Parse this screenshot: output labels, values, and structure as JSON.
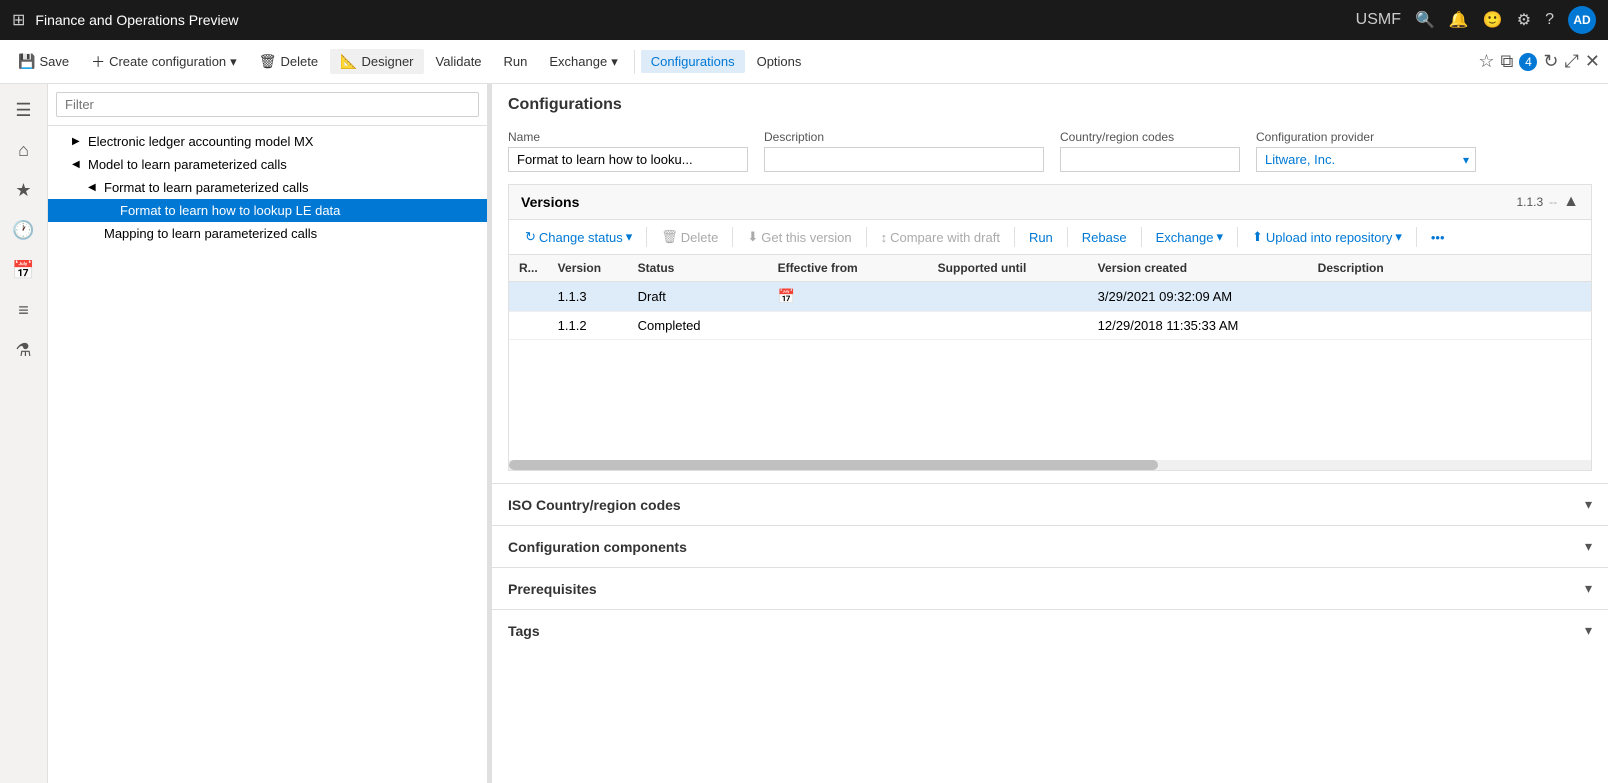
{
  "title_bar": {
    "title": "Finance and Operations Preview",
    "user": "USMF",
    "user_avatar": "AD"
  },
  "toolbar": {
    "save": "Save",
    "create_config": "Create configuration",
    "delete": "Delete",
    "designer": "Designer",
    "validate": "Validate",
    "run": "Run",
    "exchange": "Exchange",
    "configurations": "Configurations",
    "options": "Options"
  },
  "nav": {
    "filter_placeholder": "Filter",
    "items": [
      {
        "id": "electronic-ledger",
        "label": "Electronic ledger accounting model MX",
        "indent": 1,
        "arrow": "▶",
        "selected": false
      },
      {
        "id": "model-parameterized",
        "label": "Model to learn parameterized calls",
        "indent": 1,
        "arrow": "◀",
        "selected": false
      },
      {
        "id": "format-parameterized",
        "label": "Format to learn parameterized calls",
        "indent": 2,
        "arrow": "◀",
        "selected": false
      },
      {
        "id": "format-lookup",
        "label": "Format to learn how to lookup LE data",
        "indent": 3,
        "arrow": "",
        "selected": true,
        "active": true
      },
      {
        "id": "mapping-parameterized",
        "label": "Mapping to learn parameterized calls",
        "indent": 2,
        "arrow": "",
        "selected": false
      }
    ]
  },
  "content": {
    "title": "Configurations",
    "fields": {
      "name_label": "Name",
      "name_value": "Format to learn how to looku...",
      "description_label": "Description",
      "description_value": "",
      "country_label": "Country/region codes",
      "country_value": "",
      "provider_label": "Configuration provider",
      "provider_value": "Litware, Inc."
    },
    "versions": {
      "title": "Versions",
      "badge": "1.1.3",
      "separator": "--",
      "toolbar": {
        "change_status": "Change status",
        "delete": "Delete",
        "get_version": "Get this version",
        "compare_draft": "Compare with draft",
        "run": "Run",
        "rebase": "Rebase",
        "exchange": "Exchange",
        "upload_repository": "Upload into repository"
      },
      "columns": {
        "r": "R...",
        "version": "Version",
        "status": "Status",
        "effective_from": "Effective from",
        "supported_until": "Supported until",
        "version_created": "Version created",
        "description": "Description"
      },
      "rows": [
        {
          "r": "",
          "version": "1.1.3",
          "status": "Draft",
          "effective_from": "",
          "supported_until": "",
          "version_created": "3/29/2021 09:32:09 AM",
          "description": "",
          "selected": true
        },
        {
          "r": "",
          "version": "1.1.2",
          "status": "Completed",
          "effective_from": "",
          "supported_until": "",
          "version_created": "12/29/2018 11:35:33 AM",
          "description": "",
          "selected": false
        }
      ]
    },
    "sections": [
      {
        "id": "iso-country",
        "title": "ISO Country/region codes",
        "collapsed": true
      },
      {
        "id": "config-components",
        "title": "Configuration components",
        "collapsed": true
      },
      {
        "id": "prerequisites",
        "title": "Prerequisites",
        "collapsed": true
      },
      {
        "id": "tags",
        "title": "Tags",
        "collapsed": true
      }
    ]
  }
}
